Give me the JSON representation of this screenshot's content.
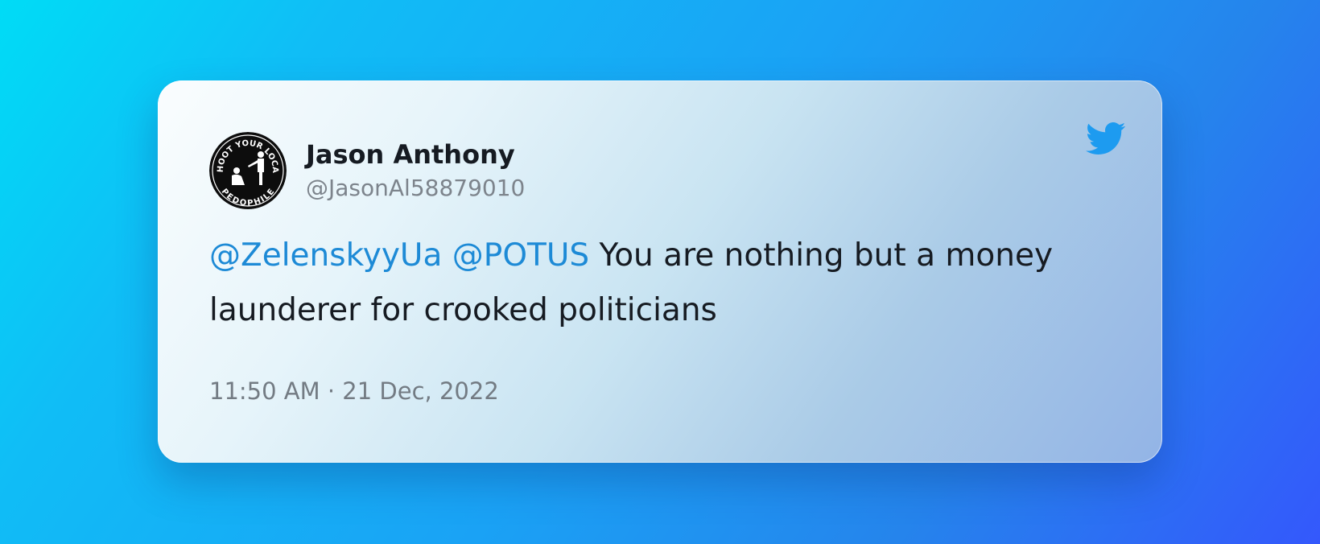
{
  "tweet": {
    "author": {
      "display_name": "Jason Anthony",
      "handle": "@JasonAl58879010",
      "avatar": {
        "text_top": "SHOOT YOUR LOCAL",
        "text_bottom": "PEDOPHILE"
      }
    },
    "text": {
      "mention_1": "@ZelenskyyUa",
      "mention_2": "@POTUS",
      "body": "You are nothing but a money launderer for crooked politicians"
    },
    "timestamp": "11:50 AM · 21 Dec, 2022"
  },
  "icons": {
    "brand": "twitter-bird-icon"
  },
  "colors": {
    "mention": "#1d8ad6",
    "twitter_blue": "#1d9bf0",
    "name": "#161b22",
    "muted": "#7d848c"
  }
}
